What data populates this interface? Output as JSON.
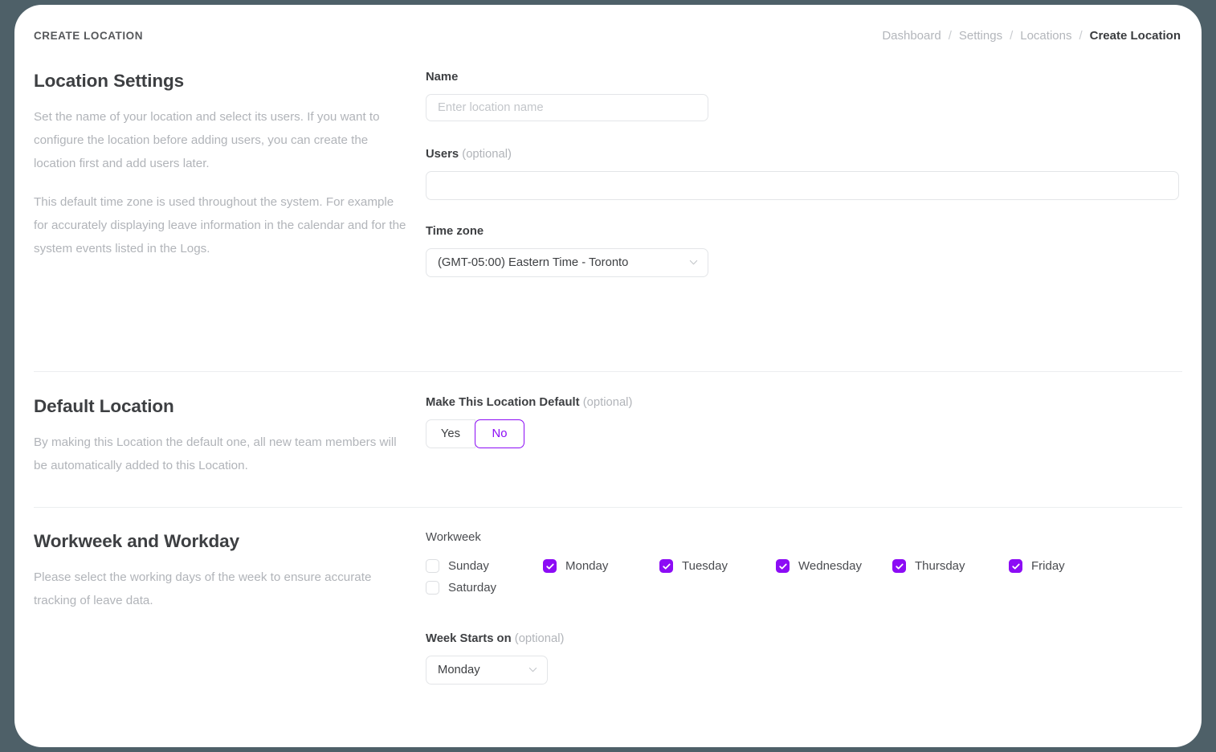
{
  "header": {
    "kicker": "CREATE LOCATION",
    "breadcrumb": [
      {
        "label": "Dashboard",
        "current": false
      },
      {
        "label": "Settings",
        "current": false
      },
      {
        "label": "Locations",
        "current": false
      },
      {
        "label": "Create Location",
        "current": true
      }
    ],
    "separator": "/"
  },
  "theme": {
    "accent": "#8c0cf5",
    "page_background": "#4e6068",
    "card_background": "#ffffff",
    "muted_text": "#b1b4b9",
    "body_text": "#3d3f42",
    "border": "#e3e5e8"
  },
  "sections": {
    "location_settings": {
      "title": "Location Settings",
      "desc1": "Set the name of your location and select its users. If you want to configure the location before adding users, you can create the location first and add users later.",
      "desc2": "This default time zone is used throughout the system. For example for accurately displaying leave information in the calendar and for the system events listed in the Logs.",
      "name_label": "Name",
      "name_value": "",
      "name_placeholder": "Enter location name",
      "users_label": "Users",
      "users_optional": "(optional)",
      "users_value": "",
      "users_placeholder": "",
      "timezone_label": "Time zone",
      "timezone_value": "(GMT-05:00) Eastern Time - Toronto"
    },
    "default_location": {
      "title": "Default Location",
      "desc": "By making this Location the default one, all new team members will be automatically added to this Location.",
      "toggle_label": "Make This Location Default",
      "toggle_optional": "(optional)",
      "options": [
        {
          "label": "Yes",
          "selected": false
        },
        {
          "label": "No",
          "selected": true
        }
      ]
    },
    "workweek": {
      "title": "Workweek and Workday",
      "desc": "Please select the working days of the week to ensure accurate tracking of leave data.",
      "workweek_label": "Workweek",
      "days": [
        {
          "label": "Sunday",
          "checked": false
        },
        {
          "label": "Monday",
          "checked": true
        },
        {
          "label": "Tuesday",
          "checked": true
        },
        {
          "label": "Wednesday",
          "checked": true
        },
        {
          "label": "Thursday",
          "checked": true
        },
        {
          "label": "Friday",
          "checked": true
        },
        {
          "label": "Saturday",
          "checked": false
        }
      ],
      "week_start_label": "Week Starts on",
      "week_start_optional": "(optional)",
      "week_start_value": "Monday"
    }
  }
}
